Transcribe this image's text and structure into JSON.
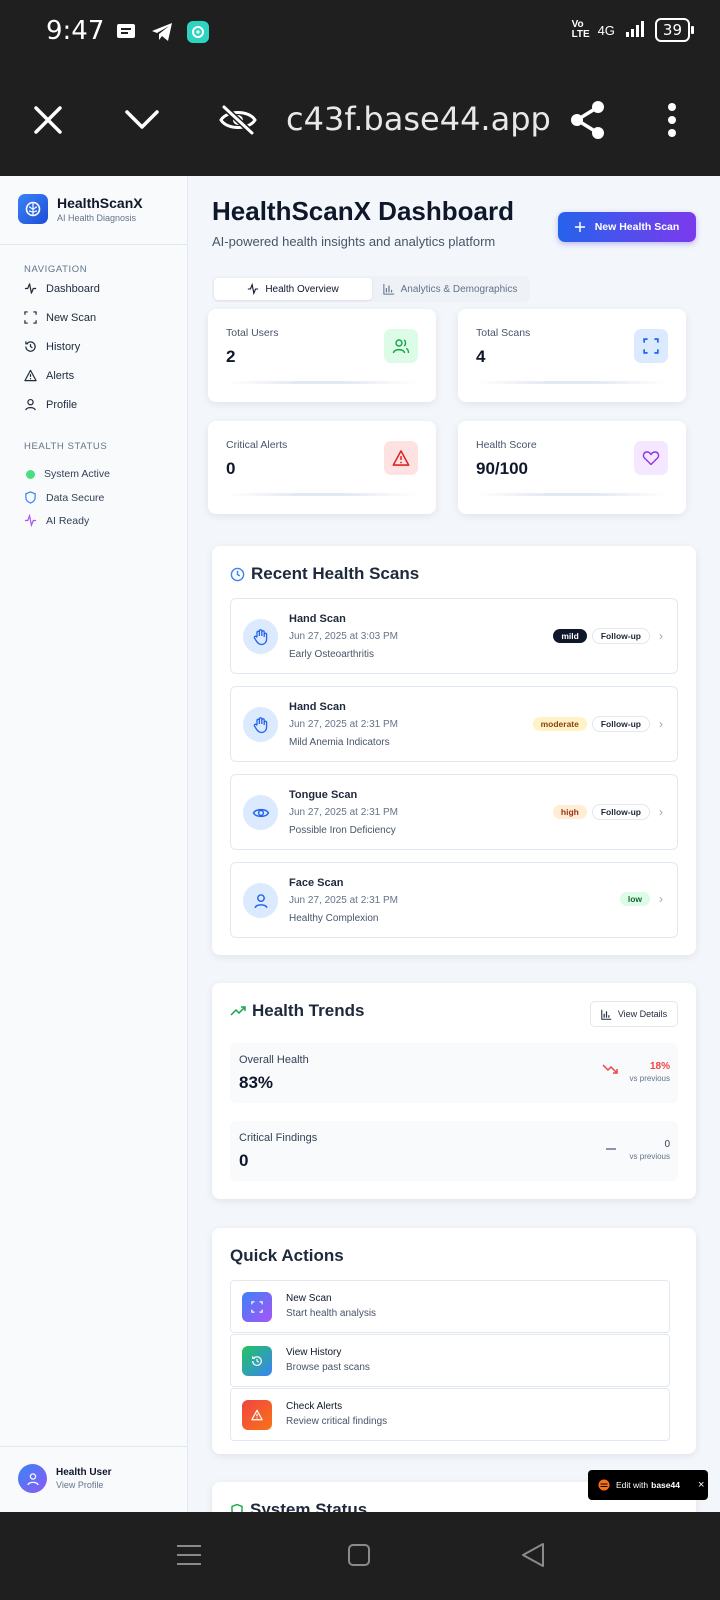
{
  "status_bar": {
    "time": "9:47",
    "network": "4G",
    "volte": "Vo LTE",
    "battery": "39"
  },
  "browser": {
    "url": "c43f.base44.app",
    "icons": [
      "close-icon",
      "chevron-down-icon",
      "eye-off-icon",
      "share-icon",
      "more-vertical-icon"
    ]
  },
  "sidebar": {
    "brand_name": "HealthScanX",
    "brand_sub": "AI Health Diagnosis",
    "nav_heading": "NAVIGATION",
    "nav_items": [
      {
        "label": "Dashboard",
        "icon": "activity-icon"
      },
      {
        "label": "New Scan",
        "icon": "scan-icon"
      },
      {
        "label": "History",
        "icon": "history-icon"
      },
      {
        "label": "Alerts",
        "icon": "alert-triangle-icon"
      },
      {
        "label": "Profile",
        "icon": "user-icon"
      }
    ],
    "status_heading": "HEALTH STATUS",
    "status_items": [
      {
        "label": "System Active",
        "icon": "green-dot-icon"
      },
      {
        "label": "Data Secure",
        "icon": "shield-icon"
      },
      {
        "label": "AI Ready",
        "icon": "activity-icon"
      }
    ],
    "user": {
      "name": "Health User",
      "sub": "View Profile"
    }
  },
  "header": {
    "title": "HealthScanX Dashboard",
    "subtitle": "AI-powered health insights and analytics platform",
    "new_scan_button": "New Health Scan"
  },
  "tabs": [
    {
      "label": "Health Overview",
      "active": true
    },
    {
      "label": "Analytics & Demographics",
      "active": false
    }
  ],
  "stats": [
    {
      "label": "Total Users",
      "value": "2",
      "icon": "users-icon",
      "color": "#dcfce7"
    },
    {
      "label": "Total Scans",
      "value": "4",
      "icon": "scan-icon",
      "color": "#dbeafe"
    },
    {
      "label": "Critical Alerts",
      "value": "0",
      "icon": "alert-triangle-icon",
      "color": "#fee2e2"
    },
    {
      "label": "Health Score",
      "value": "90/100",
      "icon": "heart-icon",
      "color": "#f3e8ff"
    }
  ],
  "recent_scans": {
    "title": "Recent Health Scans",
    "items": [
      {
        "name": "Hand Scan",
        "date": "Jun 27, 2025 at 3:03 PM",
        "finding": "Early Osteoarthritis",
        "severity": "mild",
        "follow_up": "Follow-up",
        "icon": "hand-icon"
      },
      {
        "name": "Hand Scan",
        "date": "Jun 27, 2025 at 2:31 PM",
        "finding": "Mild Anemia Indicators",
        "severity": "moderate",
        "follow_up": "Follow-up",
        "icon": "hand-icon"
      },
      {
        "name": "Tongue Scan",
        "date": "Jun 27, 2025 at 2:31 PM",
        "finding": "Possible Iron Deficiency",
        "severity": "high",
        "follow_up": "Follow-up",
        "icon": "eye-icon"
      },
      {
        "name": "Face Scan",
        "date": "Jun 27, 2025 at 2:31 PM",
        "finding": "Healthy Complexion",
        "severity": "low",
        "follow_up": "",
        "icon": "user-icon"
      }
    ]
  },
  "health_trends": {
    "title": "Health Trends",
    "view_details": "View Details",
    "items": [
      {
        "label": "Overall Health",
        "value": "83%",
        "change": "18%",
        "vs": "vs previous",
        "direction": "down",
        "color": "#ef4444"
      },
      {
        "label": "Critical Findings",
        "value": "0",
        "change": "0",
        "vs": "vs previous",
        "direction": "flat",
        "color": "#64748b"
      }
    ]
  },
  "quick_actions": {
    "title": "Quick Actions",
    "items": [
      {
        "title": "New Scan",
        "sub": "Start health analysis",
        "icon": "scan-icon"
      },
      {
        "title": "View History",
        "sub": "Browse past scans",
        "icon": "history-icon"
      },
      {
        "title": "Check Alerts",
        "sub": "Review critical findings",
        "icon": "alert-triangle-icon"
      }
    ]
  },
  "system_status": {
    "title": "System Status"
  },
  "edit_pill": {
    "prefix": "Edit with",
    "brand": "base44"
  }
}
